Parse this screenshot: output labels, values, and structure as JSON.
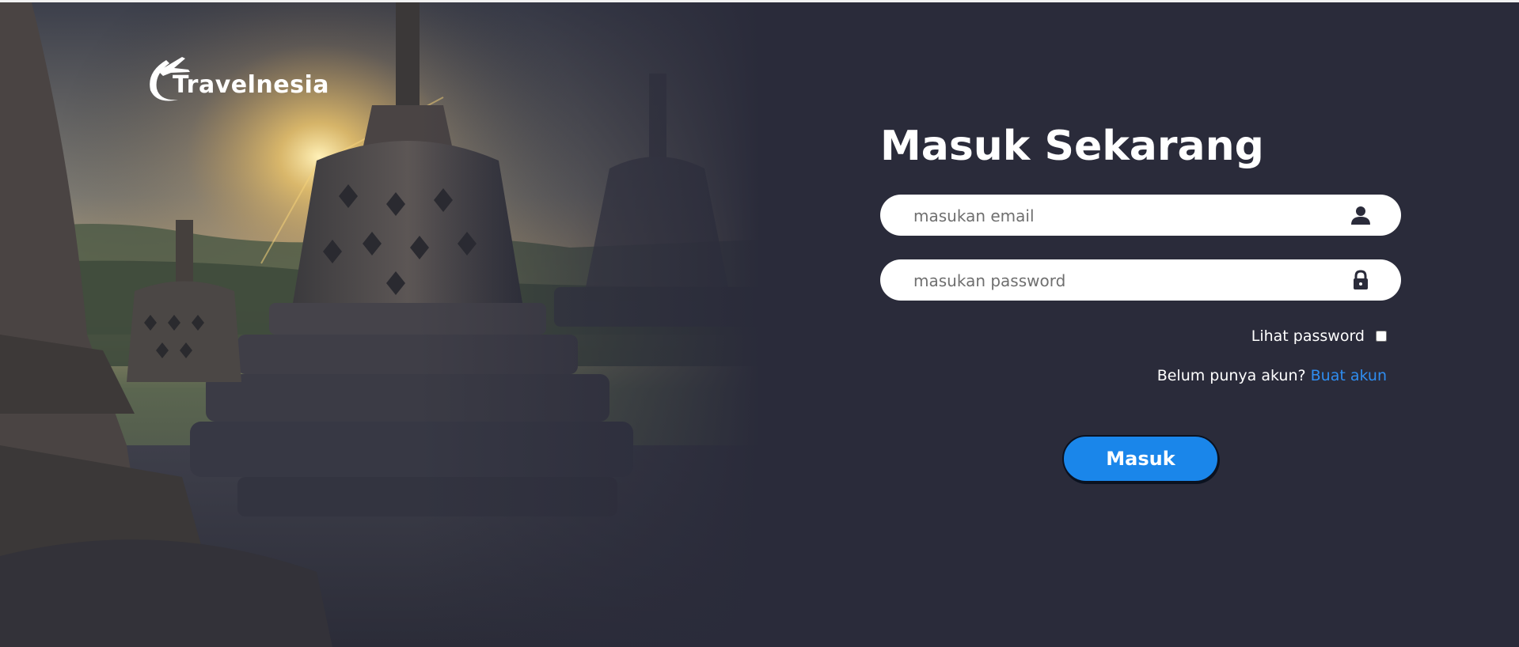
{
  "brand": {
    "name": "Travelnesia"
  },
  "login": {
    "title": "Masuk Sekarang",
    "email_placeholder": "masukan email",
    "password_placeholder": "masukan password",
    "show_password_label": "Lihat password",
    "signup_prompt": "Belum punya akun?",
    "signup_link": "Buat akun",
    "submit_label": "Masuk"
  },
  "icons": {
    "email": "user-icon",
    "password": "lock-icon",
    "logo": "airplane-swoosh-icon"
  },
  "colors": {
    "background": "#2a2b3a",
    "accent": "#1a86ea",
    "link": "#2f8df0",
    "field": "#ffffff"
  }
}
